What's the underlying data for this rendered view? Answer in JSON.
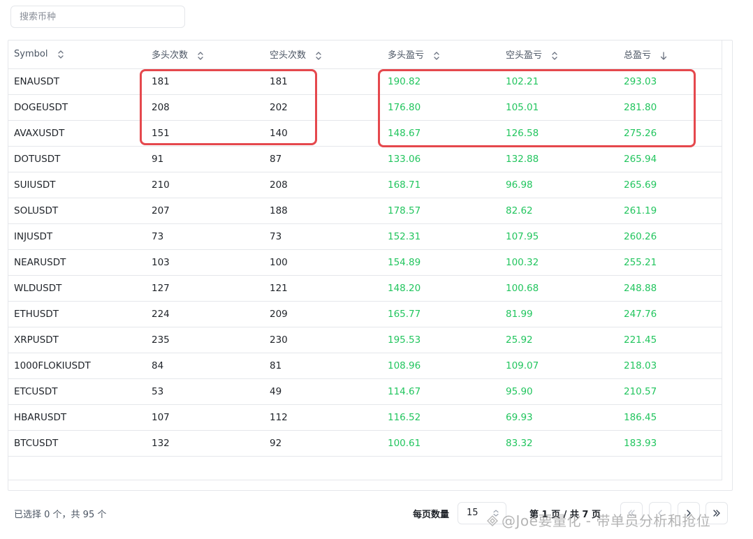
{
  "search": {
    "placeholder": "搜索币种"
  },
  "table": {
    "headers": [
      "Symbol",
      "多头次数",
      "空头次数",
      "多头盈亏",
      "空头盈亏",
      "总盈亏"
    ],
    "rows": [
      [
        "ENAUSDT",
        "181",
        "181",
        "190.82",
        "102.21",
        "293.03"
      ],
      [
        "DOGEUSDT",
        "208",
        "202",
        "176.80",
        "105.01",
        "281.80"
      ],
      [
        "AVAXUSDT",
        "151",
        "140",
        "148.67",
        "126.58",
        "275.26"
      ],
      [
        "DOTUSDT",
        "91",
        "87",
        "133.06",
        "132.88",
        "265.94"
      ],
      [
        "SUIUSDT",
        "210",
        "208",
        "168.71",
        "96.98",
        "265.69"
      ],
      [
        "SOLUSDT",
        "207",
        "188",
        "178.57",
        "82.62",
        "261.19"
      ],
      [
        "INJUSDT",
        "73",
        "73",
        "152.31",
        "107.95",
        "260.26"
      ],
      [
        "NEARUSDT",
        "103",
        "100",
        "154.89",
        "100.32",
        "255.21"
      ],
      [
        "WLDUSDT",
        "127",
        "121",
        "148.20",
        "100.68",
        "248.88"
      ],
      [
        "ETHUSDT",
        "224",
        "209",
        "165.77",
        "81.99",
        "247.76"
      ],
      [
        "XRPUSDT",
        "235",
        "230",
        "195.53",
        "25.92",
        "221.45"
      ],
      [
        "1000FLOKIUSDT",
        "84",
        "81",
        "108.96",
        "109.07",
        "218.03"
      ],
      [
        "ETCUSDT",
        "53",
        "49",
        "114.67",
        "95.90",
        "210.57"
      ],
      [
        "HBARUSDT",
        "107",
        "112",
        "116.52",
        "69.93",
        "186.45"
      ],
      [
        "BTCUSDT",
        "132",
        "92",
        "100.61",
        "83.32",
        "183.93"
      ]
    ]
  },
  "footer": {
    "selection": "已选择 0 个，共 95 个",
    "per_page_label": "每页数量",
    "per_page_value": "15",
    "page_info": "第 1 页 / 共 7 页"
  },
  "watermark": "@Joe要量化 - 带单员分析和抢位",
  "colors": {
    "positive": "#22c55e",
    "highlight": "#e5484d"
  }
}
